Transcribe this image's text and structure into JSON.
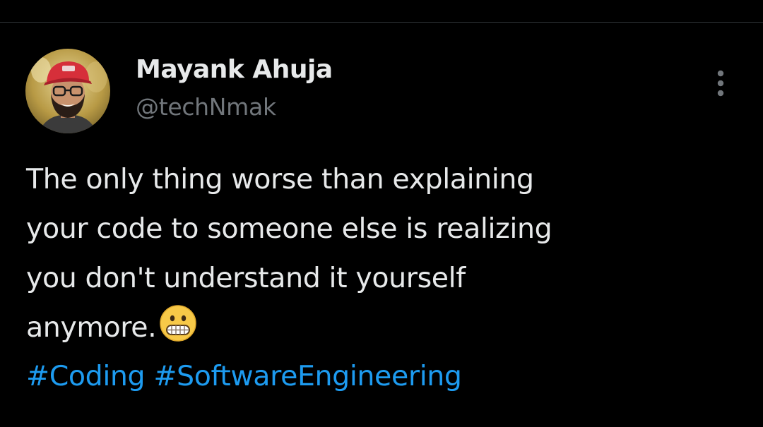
{
  "author": {
    "name": "Mayank Ahuja",
    "handle": "@techNmak",
    "avatar": "avatar-photo"
  },
  "tweet": {
    "lines": [
      "The only thing worse than explaining",
      "your code to someone else is realizing",
      "you don't understand it yourself",
      "anymore."
    ],
    "emoji": "grimacing-face",
    "hashtags": [
      "#Coding",
      "#SoftwareEngineering"
    ]
  },
  "menu": {
    "icon": "more-vertical-icon"
  },
  "colors": {
    "background": "#000000",
    "text": "#e7e9ea",
    "secondary_text": "#71767b",
    "link": "#1d9bf0",
    "divider": "#2f3336"
  }
}
